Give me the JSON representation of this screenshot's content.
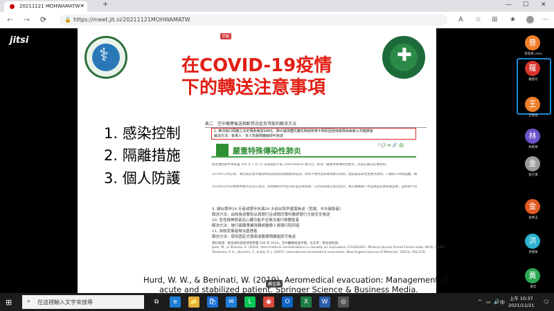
{
  "browser": {
    "tab_title": "20211121 MOHWAMATW",
    "new_tab": "+",
    "url": "https://meet.jit.si/20211121MOHWAMATW",
    "win_controls": [
      "—",
      "☐",
      "✕"
    ],
    "nav": [
      "←",
      "→",
      "⟳"
    ]
  },
  "meeting": {
    "app_logo": "jitsi",
    "slide": {
      "badge": "原圖",
      "title_line1": "在COVID-19疫情",
      "title_line2": "下的轉送注意事項",
      "points": [
        "1.  感染控制",
        "2.  隔離措施",
        "3.  個人防護"
      ],
      "document": {
        "table_heading": "表二　空中傷患後送相對禁忌症及可能的解決方法",
        "highlight_lines": [
          "1. 無法執行隔離之法定傳染病如SARS，肺炎鏈球菌抗藥性肺結核等不明原因發燒或傳染病者公共健康者",
          "   解決方法：有單人／多人負壓隔離艙即可後送"
        ],
        "disease_title": "嚴重特殊傳染性肺炎",
        "share_icons": "f  💬  ✉  🔗  🖨",
        "paragraphs": [
          "衛生福利部中華民國 109 年 1 月 15 日衛授疾字第 1090100030 號公告，新增「嚴重特殊傳染性肺炎」為第五類法定傳染病。",
          "2019年12月以來，湖北省武漢市展開呼吸道疾病及相關疾病監測，發現不明原因病毒性肺炎病例，個案臨床表現主要為發熱，少數病人呼吸困難，胸部X光片呈雙肺浸潤性病灶。",
          "2020年1月9日依據中國大陸官方說法，病原體初步判定為新型冠狀病毒，已完成病毒全基因定序，電子顯微鏡下亦呈典型冠狀病毒型態；該病毒不同於以往發現的人類冠狀病毒，冠狀病毒以2019-nCoV命名，可感染動物及人類。"
        ],
        "rows": [
          "9. 疑似懷孕24 天者或懷孕未滿24 天前出院早產需後送（宮縮、羊水破裂者）",
          "   解決方法：由該後送醫院派員隨行且或隨同專科醫師隨行方能安全後送",
          "10. 急性精神病者及心臟功能不全無法進行無醫監者",
          "    解決方法：施行鎮靜專業除顫或醫療人員隨行陪同者",
          "11. 自殺受傷者無法處理者",
          "    解決方法：使用固定式擔架或醫療隔離艙即可後送"
        ],
        "refs": [
          "資料來源：衛生福利部疾病管制署 109 年 2014，空中醫療後送手冊，台北市：衛生福利部。",
          "Joshi, M., & Sharma, R. (2020). Aero-medical considerations in casualty air evacuation (CASAEVAC). Medical Journal Armed Forces India, 66(4), 63-65.",
          "Teichman, P. G., Donchin, Y., & Kot, R. J. (2007). International aeromedical evacuation. New England Journal of Medicine, 356(3), 262-270."
        ]
      },
      "credit_line1": "Hurd, W. W., & Beninati, W. (2019). Aeromedical evacuation: Management of",
      "credit_line2": "acute and stabilized patient. Springer Science & Business Media.",
      "speaker_caption": "蘇佳楓"
    },
    "participants": [
      {
        "initial": "曾",
        "name": "曾宛真 (me)",
        "color": "#f07f2a"
      },
      {
        "initial": "羅",
        "name": "羅鈺珩",
        "color": "#d8342c"
      },
      {
        "initial": "王",
        "name": "王銘佑",
        "color": "#f07f2a"
      },
      {
        "initial": "林",
        "name": "林家華",
        "color": "#6c52c9"
      },
      {
        "initial": "金",
        "name": "金大偉",
        "color": "#9a9a9a"
      },
      {
        "initial": "金",
        "name": "金佩玉",
        "color": "#e05a22"
      },
      {
        "initial": "洪",
        "name": "洪建華",
        "color": "#2bb2cf"
      },
      {
        "initial": "黃",
        "name": "黃宏",
        "color": "#2aa852"
      }
    ]
  },
  "taskbar": {
    "search_placeholder": "在這裡輸入文字來搜尋",
    "apps": [
      {
        "icon": "task-view-icon",
        "glyph": "⧉",
        "color": "#1c1c1c"
      },
      {
        "icon": "edge-icon",
        "glyph": "e",
        "color": "#1f7ed6"
      },
      {
        "icon": "file-explorer-icon",
        "glyph": "📁",
        "color": "#e2b13c"
      },
      {
        "icon": "store-icon",
        "glyph": "🛍",
        "color": "#1c6fd6"
      },
      {
        "icon": "mail-icon",
        "glyph": "✉",
        "color": "#1f7ed6"
      },
      {
        "icon": "line-icon",
        "glyph": "L",
        "color": "#06c755"
      },
      {
        "icon": "chrome-icon",
        "glyph": "◉",
        "color": "#d94a3b"
      },
      {
        "icon": "outlook-icon",
        "glyph": "O",
        "color": "#0f63c4"
      },
      {
        "icon": "excel-icon",
        "glyph": "X",
        "color": "#1f7c45"
      },
      {
        "icon": "word-icon",
        "glyph": "W",
        "color": "#2a5caa"
      },
      {
        "icon": "record-icon",
        "glyph": "◎",
        "color": "#555"
      }
    ],
    "tray_chevron": "^",
    "ime": "中",
    "time": "上午 10:37",
    "date": "2021/11/21"
  }
}
